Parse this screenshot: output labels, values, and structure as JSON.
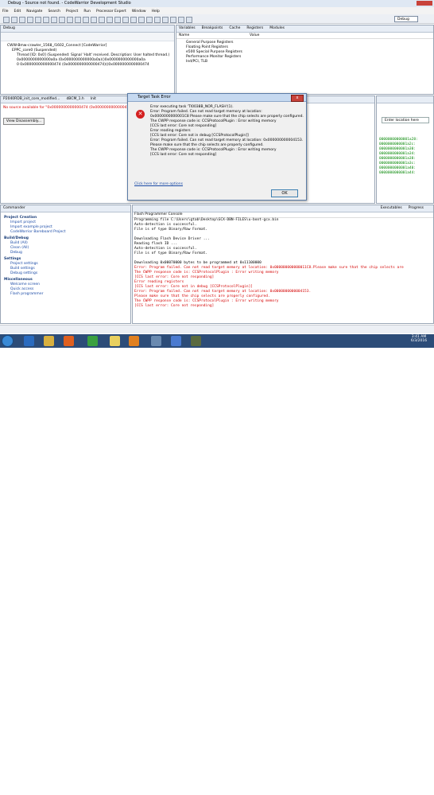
{
  "window": {
    "title": "Debug - Source not found. - CodeWarrior Development Studio"
  },
  "menu": [
    "File",
    "Edit",
    "Navigate",
    "Search",
    "Project",
    "Run",
    "Processor Expert",
    "Window",
    "Help"
  ],
  "perspective": {
    "label": "Debug"
  },
  "debug_panel": {
    "tab": "Debug",
    "rows": [
      "CWW-Bmw-crawler_1568_/1602_Connect [CodeWarrior]",
      "EPPC_core0 (Suspended)",
      "Thread [ID: 0x0] (Suspended: Signal 'Halt' received. Description: User halted thread.)",
      "0x0000000000000a0a (0x0000000000000a0a)()0x0000000000000a0a",
      "0 0x0000000000000474 (0x0000000000000474)()0x0000000000000474"
    ]
  },
  "registers_panel": {
    "tabs": [
      "Variables",
      "Breakpoints",
      "Cache",
      "Registers",
      "Modules"
    ],
    "columns": [
      "Name",
      "Value"
    ],
    "rows": [
      "General Purpose Registers",
      "Floating Point Registers",
      "e500 Special Purpose Registers",
      "Performance Monitor Registers",
      "Ind/PCI, TLB"
    ]
  },
  "editor": {
    "tabs": [
      "P2040RDB_init_core_modified...",
      "dBCM_1.h",
      "Init"
    ],
    "message": "No source available for \"0x0000000000000474 (0x0000000000000474)()\"",
    "button": "View Disassembly..."
  },
  "memory_panel": {
    "location_label": "Enter location here",
    "addresses": [
      "00000000000001a28:",
      "0000000000001a2c:",
      "0000000000001a30:",
      "0000000000001a34:",
      "0000000000001a38:",
      "0000000000001a3c:",
      "0000000000001a40:",
      "0000000000001a44:"
    ]
  },
  "dialog": {
    "title": "Target Task Error",
    "close": "x",
    "lines": [
      "Error executing task 'TI0038B_NOR_FLASH'(1).",
      "Error: Program failed. Can not read target memory at location:",
      "0x0000000000001C8 Please make sure that the chip selects are properly configured.",
      "The CWPP response code is: CCSProtocolPlugin : Error writing memory",
      "[CCS last error: Core not responding]",
      "Error reading registers",
      "[CCS last error: Core not in debug [CCSProtocolPlugin]]",
      "Error: Program failed. Can not read target memory at location: 0x000000000004153.",
      "Please make sure that the chip selects are properly configured.",
      "The CWPP response code is: CCSProtocolPlugin : Error writing memory",
      "[CCS last error: Core not responding]"
    ],
    "link": "Click here for more options",
    "ok": "OK"
  },
  "commander": {
    "tab": "Commander",
    "sections": [
      {
        "title": "Project Creation",
        "items": [
          "Import project",
          "Import example project",
          "CodeWarrior Bareboard Project"
        ]
      },
      {
        "title": "Build/Debug",
        "items": [
          "Build (All)",
          "Clean (All)",
          "Debug"
        ]
      },
      {
        "title": "Settings",
        "items": [
          "Project settings",
          "Build settings",
          "Debug settings"
        ]
      },
      {
        "title": "Miscellaneous",
        "items": [
          "Welcome screen",
          "Quick access",
          "Flash programmer"
        ]
      }
    ]
  },
  "console": {
    "tabs": [
      "Executables",
      "Progress"
    ],
    "title": "Flash Programmer Console",
    "lines": [
      {
        "t": "Programming file C:\\Users\\gtab\\Desktop\\GCX-DBN-FILES\\u-boot-gcx.bin",
        "c": "black"
      },
      {
        "t": "Auto-detection is successful.",
        "c": "black"
      },
      {
        "t": "  File is of type Binary/Raw Format.",
        "c": "black"
      },
      {
        "t": "",
        "c": "black"
      },
      {
        "t": " Downloading Flash Device Driver ...",
        "c": "black"
      },
      {
        "t": "  Reading flash ID ...",
        "c": "black"
      },
      {
        "t": "Auto-detection is successful.",
        "c": "black"
      },
      {
        "t": "  File is of type Binary/Raw Format.",
        "c": "black"
      },
      {
        "t": "",
        "c": "black"
      },
      {
        "t": "Downloading 0x00070000 bytes to be programmed at 0x11100000",
        "c": "black"
      },
      {
        "t": "Error: Program failed. Can not read target memory at location: 0x000000000000011C8.Please make sure that the chip selects are",
        "c": "red"
      },
      {
        "t": "The CWPP response code is: CCSProtocolPlugin : Error writing memory",
        "c": "red"
      },
      {
        "t": "[CCS last error: Core not responding]",
        "c": "red"
      },
      {
        "t": "Error reading registers",
        "c": "red"
      },
      {
        "t": "[CCS last error: Core not in debug [CCSProtocolPlugin]]",
        "c": "red"
      },
      {
        "t": "Error: Program failed. Can not read target memory at location: 0x0000000000004153.",
        "c": "red"
      },
      {
        "t": "Please make sure that the chip selects are properly configured.",
        "c": "red"
      },
      {
        "t": "The CWPP response code is: CCSProtocolPlugin : Error writing memory",
        "c": "red"
      },
      {
        "t": "[CCS last error: Core not responding]",
        "c": "red"
      }
    ]
  },
  "taskbar": {
    "time": "3:41 AM",
    "date": "6/3/2016"
  }
}
